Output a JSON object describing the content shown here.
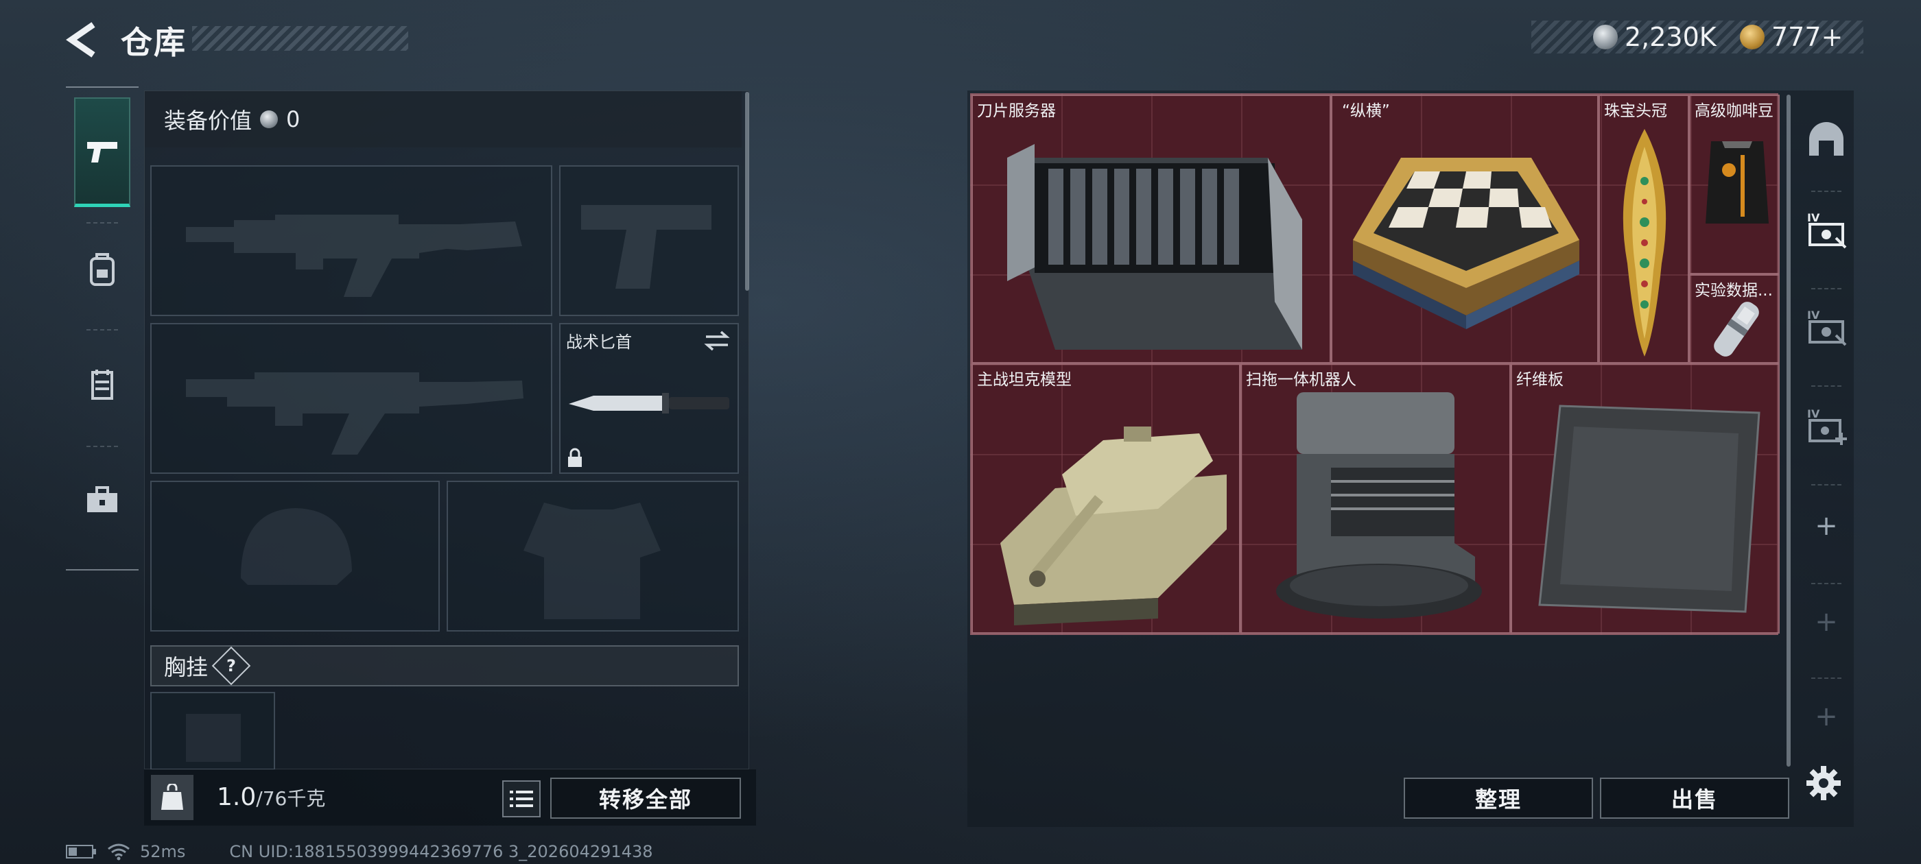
{
  "header": {
    "title": "仓库",
    "currency": [
      {
        "icon": "silver-coin-icon",
        "value": "2,230K"
      },
      {
        "icon": "gold-coin-icon",
        "value": "777+"
      }
    ]
  },
  "left_nav": [
    "pistol-icon",
    "backpack-icon",
    "armor-vest-icon",
    "toolbox-icon"
  ],
  "equipment": {
    "value_label": "装备价值",
    "value": "0",
    "knife_slot_label": "战术匕首",
    "chest_rig_label": "胸挂",
    "chest_rig_help": "?"
  },
  "weight": {
    "current": "1.0",
    "capacity": "/76千克"
  },
  "buttons": {
    "transfer_all": "转移全部",
    "sort": "整理",
    "sell": "出售"
  },
  "status_bar": {
    "ping": "52ms",
    "uid": "CN UID:18815503999442369776 3_202604291438"
  },
  "stash_items": [
    {
      "name": "刀片服务器",
      "icon": "blade-server-icon"
    },
    {
      "name": "“纵横”",
      "icon": "chess-set-icon"
    },
    {
      "name": "珠宝头冠",
      "icon": "jeweled-crown-icon"
    },
    {
      "name": "高级咖啡豆",
      "icon": "coffee-bag-icon"
    },
    {
      "name": "实验数据...",
      "icon": "data-capsule-icon"
    },
    {
      "name": "主战坦克模型",
      "icon": "tank-model-icon"
    },
    {
      "name": "扫拖一体机器人",
      "icon": "robot-vacuum-icon"
    },
    {
      "name": "纤维板",
      "icon": "carbon-fiber-board-icon"
    }
  ],
  "right_nav": [
    "helmet-icon",
    "case-icon",
    "case-icon",
    "case-add-icon",
    "+",
    "+",
    "+"
  ]
}
